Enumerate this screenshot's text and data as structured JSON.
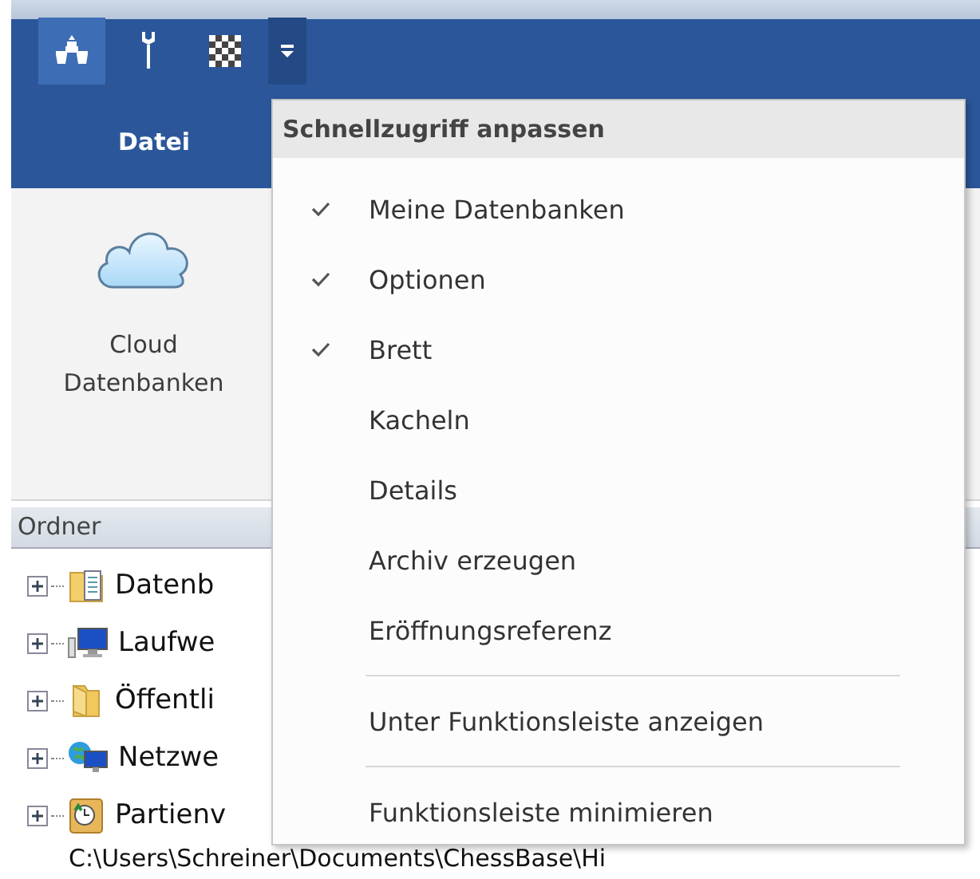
{
  "quick_access_toolbar": {
    "buttons": [
      {
        "kind": "pieces",
        "selected": true
      },
      {
        "kind": "wrench",
        "selected": false
      },
      {
        "kind": "board",
        "selected": false
      }
    ],
    "customize_button": {
      "open": true
    }
  },
  "ribbon": {
    "tabs": [
      {
        "label": "Datei",
        "selected": false
      }
    ],
    "buttons": [
      {
        "label": "Cloud Datenbanken"
      }
    ]
  },
  "folder_pane": {
    "title": "Ordner",
    "items": [
      {
        "label": "Datenb",
        "kind": "database-folder",
        "expanded": false
      },
      {
        "label": "Laufwe",
        "kind": "drives",
        "expanded": false
      },
      {
        "label": "Öffentli",
        "kind": "folder",
        "expanded": false
      },
      {
        "label": "Netzwe",
        "kind": "network",
        "expanded": false
      },
      {
        "label": "Partienv",
        "kind": "history",
        "expanded": false
      }
    ],
    "path_row": "C:\\Users\\Schreiner\\Documents\\ChessBase\\Hi"
  },
  "menu": {
    "title": "Schnellzugriff anpassen",
    "items": [
      {
        "kind": "item",
        "label": "Meine Datenbanken",
        "checked": true
      },
      {
        "kind": "item",
        "label": "Optionen",
        "checked": true
      },
      {
        "kind": "item",
        "label": "Brett",
        "checked": true
      },
      {
        "kind": "item",
        "label": "Kacheln",
        "checked": false
      },
      {
        "kind": "item",
        "label": "Details",
        "checked": false
      },
      {
        "kind": "item",
        "label": "Archiv erzeugen",
        "checked": false
      },
      {
        "kind": "item",
        "label": "Eröffnungsreferenz",
        "checked": false
      },
      {
        "kind": "separator"
      },
      {
        "kind": "item",
        "label": "Unter Funktionsleiste anzeigen",
        "checked": false
      },
      {
        "kind": "separator"
      },
      {
        "kind": "item",
        "label": "Funktionsleiste minimieren",
        "checked": false
      }
    ]
  }
}
